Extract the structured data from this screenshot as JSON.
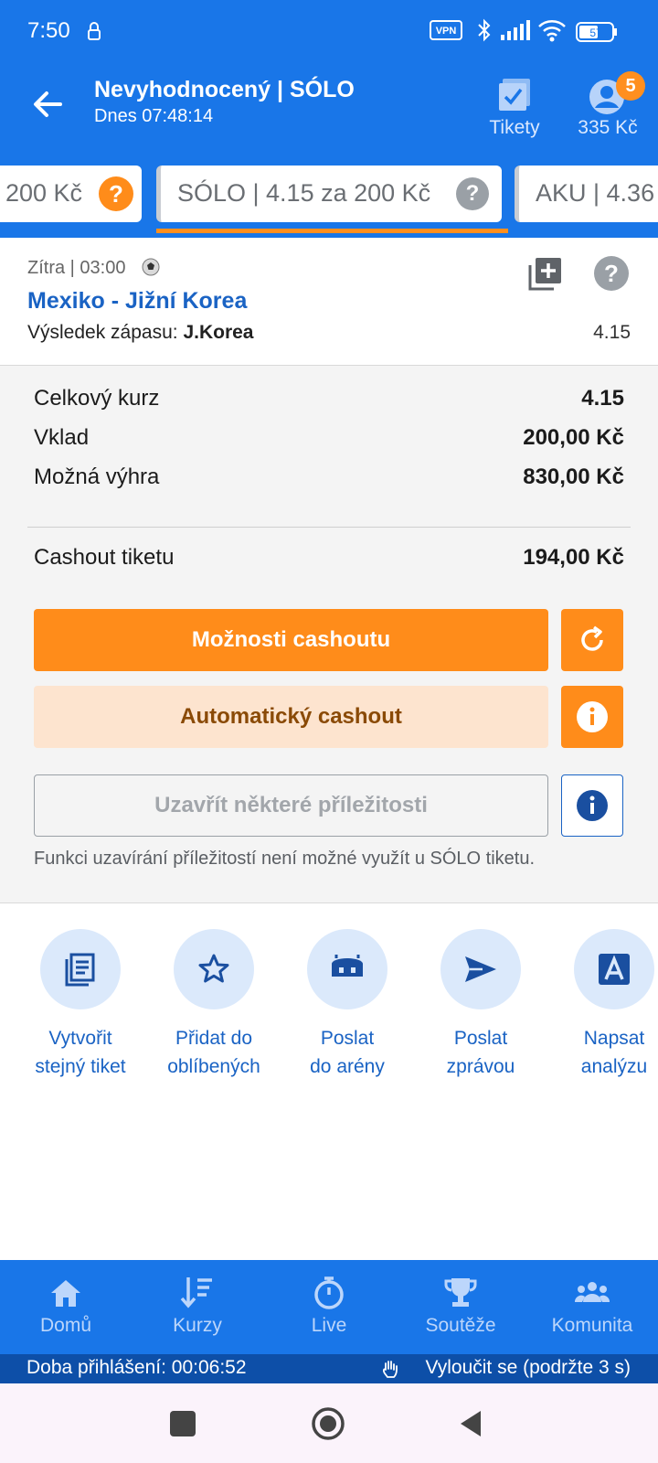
{
  "status": {
    "time": "7:50",
    "vpn": "VPN",
    "battery": "57"
  },
  "header": {
    "title": "Nevyhodnocený | SÓLO",
    "subtitle": "Dnes 07:48:14",
    "tickets_label": "Tikety",
    "balance_label": "335 Kč",
    "badge_count": "5"
  },
  "tabs": [
    {
      "label": "200 Kč"
    },
    {
      "label": "SÓLO  | 4.15 za 200 Kč"
    },
    {
      "label": "AKU  | 4.36"
    }
  ],
  "tab_help": "?",
  "match": {
    "time": "Zítra  | 03:00",
    "name": "Mexiko - Jižní Korea",
    "result_label": "Výsledek zápasu:",
    "result_value": "J.Korea",
    "odd": "4.15"
  },
  "summary": {
    "total_odds_label": "Celkový kurz",
    "total_odds_value": "4.15",
    "stake_label": "Vklad",
    "stake_value": "200,00 Kč",
    "win_label": "Možná výhra",
    "win_value": "830,00 Kč",
    "cashout_label": "Cashout tiketu",
    "cashout_value": "194,00 Kč"
  },
  "buttons": {
    "cashout_options": "Možnosti cashoutu",
    "auto_cashout": "Automatický cashout",
    "close_some": "Uzavřít některé příležitosti"
  },
  "note": "Funkci uzavírání příležitostí není možné využít u SÓLO tiketu.",
  "actions": [
    {
      "line1": "Vytvořit",
      "line2": "stejný tiket"
    },
    {
      "line1": "Přidat do",
      "line2": "oblíbených"
    },
    {
      "line1": "Poslat",
      "line2": "do arény"
    },
    {
      "line1": "Poslat",
      "line2": "zprávou"
    },
    {
      "line1": "Napsat",
      "line2": "analýzu"
    }
  ],
  "nav": [
    {
      "label": "Domů"
    },
    {
      "label": "Kurzy"
    },
    {
      "label": "Live"
    },
    {
      "label": "Soutěže"
    },
    {
      "label": "Komunita"
    }
  ],
  "session": {
    "login_time": "Doba přihlášení: 00:06:52",
    "exclude": "Vyloučit se (podržte 3 s)"
  },
  "colors": {
    "primary": "#1976e8",
    "accent": "#ff8c1a",
    "link": "#1a63c4"
  }
}
